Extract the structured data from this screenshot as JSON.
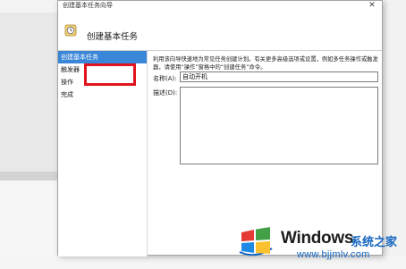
{
  "window": {
    "title": "创建基本任务向导",
    "close_glyph": "✕"
  },
  "header": {
    "title": "创建基本任务",
    "icon": "task-wizard-icon"
  },
  "steps": [
    {
      "label": "创建基本任务",
      "active": true
    },
    {
      "label": "触发器",
      "active": false
    },
    {
      "label": "操作",
      "active": false
    },
    {
      "label": "完成",
      "active": false
    }
  ],
  "form": {
    "description_text": "利用该向导快速地为常见任务创建计划。有关更多高级选项或设置，例如多任务操作或触发器，请使用“操作”窗格中的“创建任务”命令。",
    "name_label": "名称(A):",
    "name_value": "自动开机",
    "desc_label": "描述(D):",
    "desc_value": ""
  },
  "watermark": {
    "title": "Windows",
    "subtitle": "系统之家",
    "url": "www.bjjmlv.com"
  },
  "colors": {
    "accent": "#3a86d8",
    "highlight": "#e0141e",
    "watermark_blue": "#1565c0"
  }
}
